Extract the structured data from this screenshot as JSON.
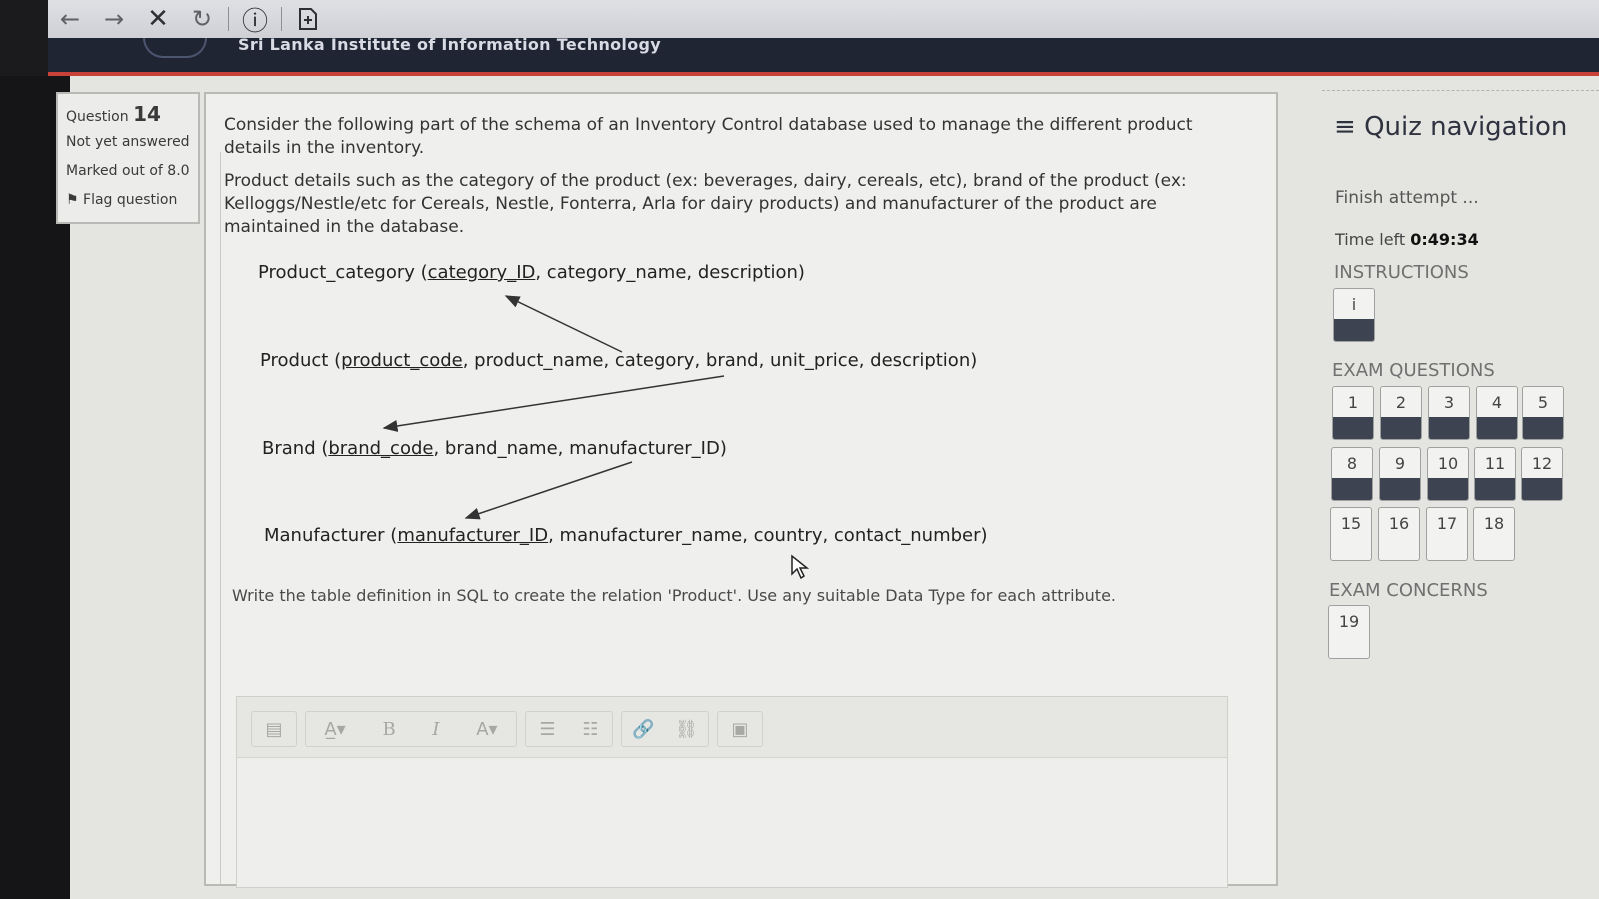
{
  "browser": {
    "back_icon": "←",
    "forward_icon": "→",
    "stop_icon": "✕",
    "reload_icon": "↻",
    "info_icon": "ⓘ",
    "new_tab_icon": "+"
  },
  "site": {
    "title": "Sri Lanka Institute of Information Technology"
  },
  "question_info": {
    "question_label": "Question",
    "question_number": "14",
    "status": "Not yet answered",
    "marked_out_of": "Marked out of 8.0",
    "flag_label": "Flag question"
  },
  "question": {
    "intro": "Consider the following part of the schema of an Inventory Control database used to manage the different product details in the inventory.",
    "details": "Product details such as the category of the product (ex: beverages, dairy, cereals, etc), brand of the product (ex: Kelloggs/Nestle/etc for Cereals, Nestle, Fonterra, Arla for dairy products) and manufacturer of the product are maintained in the database.",
    "schema": {
      "product_category": {
        "name": "Product_category (",
        "key": "category_ID",
        "rest": ", category_name, description)"
      },
      "product": {
        "name": "Product (",
        "key": "product_code",
        "rest": ", product_name, category, brand, unit_price, description)"
      },
      "brand": {
        "name": "Brand (",
        "key": "brand_code",
        "rest": ", brand_name, manufacturer_ID)"
      },
      "manufacturer": {
        "name": "Manufacturer (",
        "key": "manufacturer_ID",
        "rest": ", manufacturer_name, country, contact_number)"
      }
    },
    "prompt": "Write the table definition in SQL to create the relation 'Product'. Use any suitable Data Type for each attribute."
  },
  "editor_toolbar": {
    "toggle": "▤",
    "format": "A̲▾",
    "bold": "B",
    "italic": "I",
    "font_color": "A▾",
    "unordered_list": "☰",
    "ordered_list": "☷",
    "link": "🔗",
    "unlink": "⛓",
    "image": "▣"
  },
  "quiz_nav": {
    "menu_icon": "≡",
    "title": "Quiz navigation",
    "finish": "Finish attempt ...",
    "time_left_label": "Time left",
    "time_left_value": "0:49:34",
    "instructions_title": "INSTRUCTIONS",
    "instructions_button": "i",
    "exam_questions_title": "EXAM QUESTIONS",
    "q1": "1",
    "q2": "2",
    "q3": "3",
    "q4": "4",
    "q5": "5",
    "q8": "8",
    "q9": "9",
    "q10": "10",
    "q11": "11",
    "q12": "12",
    "q15": "15",
    "q16": "16",
    "q17": "17",
    "q18": "18",
    "exam_concerns_title": "EXAM CONCERNS",
    "q19": "19"
  }
}
